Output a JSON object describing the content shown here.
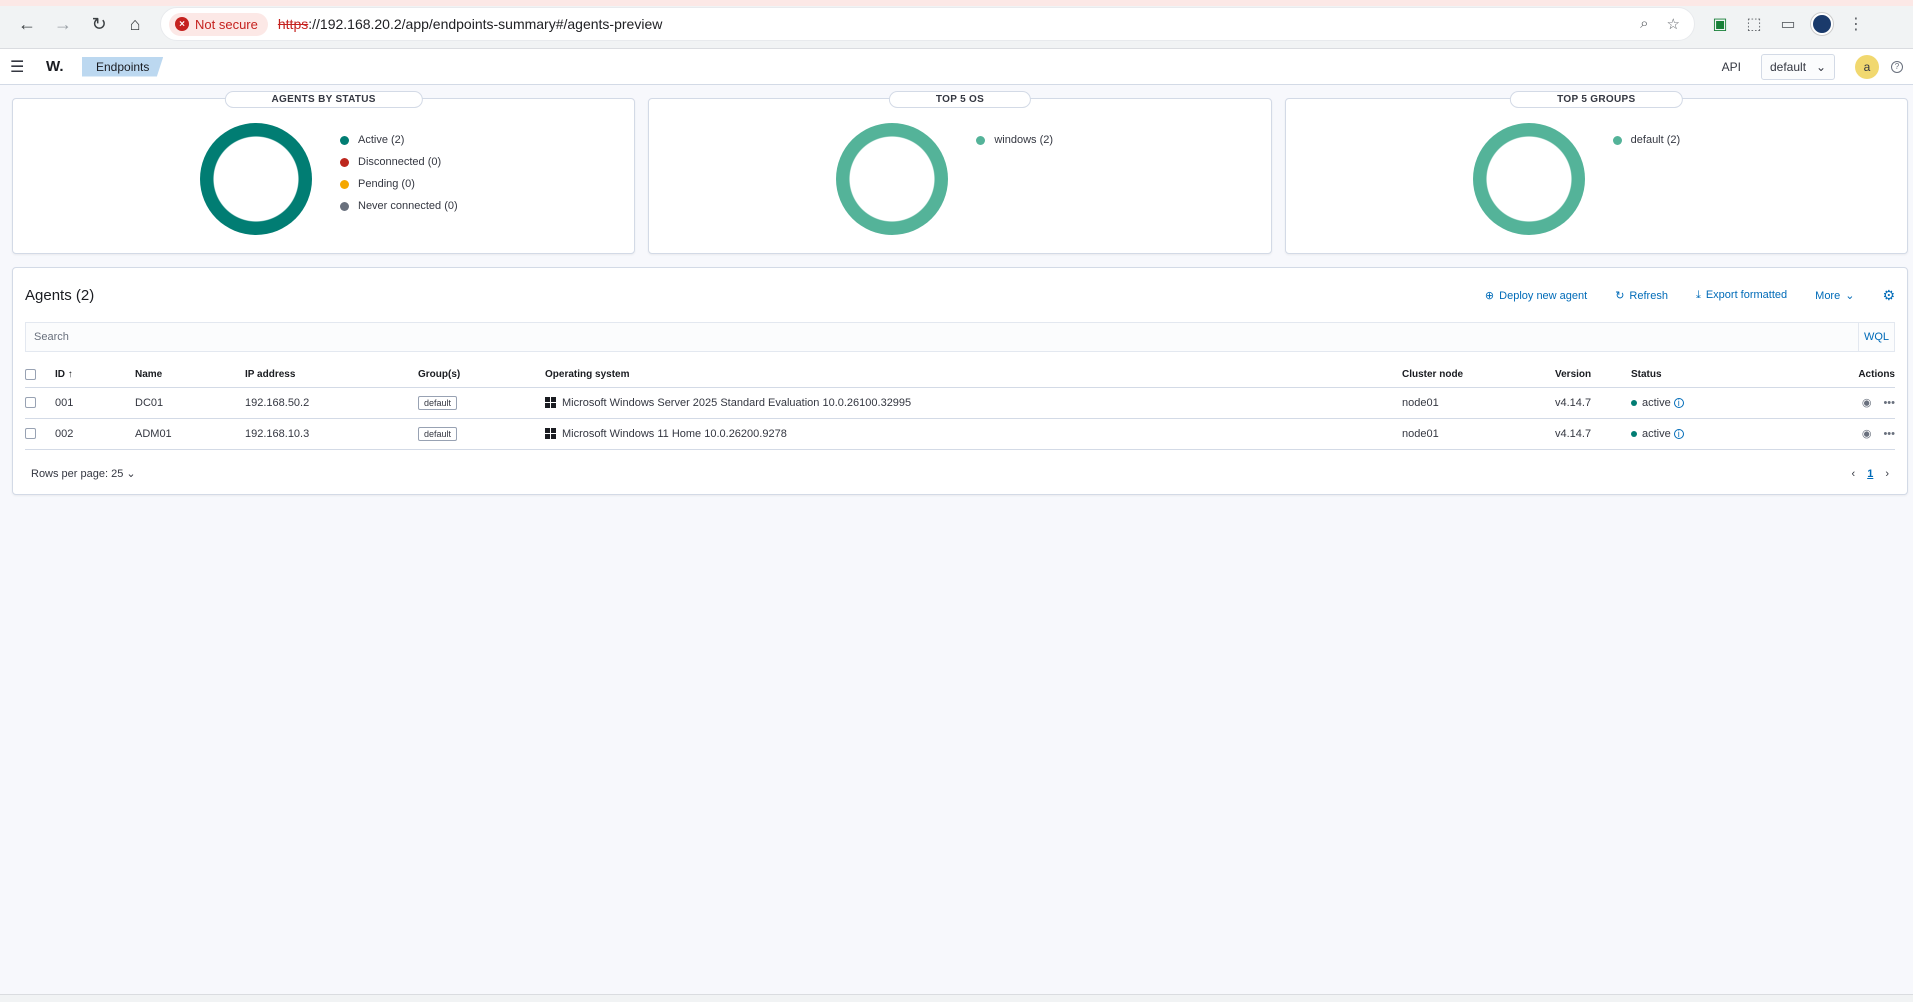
{
  "browser": {
    "not_secure": "Not secure",
    "url_scheme": "https",
    "url_rest": "://192.168.20.2/app/endpoints-summary#/agents-preview"
  },
  "appbar": {
    "logo": "W.",
    "breadcrumb": "Endpoints",
    "api": "API",
    "tenant": "default",
    "avatar": "a"
  },
  "panels": [
    {
      "title": "AGENTS BY STATUS",
      "legend": [
        {
          "label": "Active (2)",
          "color": "#017d73"
        },
        {
          "label": "Disconnected (0)",
          "color": "#bd271e"
        },
        {
          "label": "Pending (0)",
          "color": "#f5a700"
        },
        {
          "label": "Never connected (0)",
          "color": "#69707d"
        }
      ],
      "donut_color": "#017d73"
    },
    {
      "title": "TOP 5 OS",
      "legend": [
        {
          "label": "windows (2)",
          "color": "#54b399"
        }
      ],
      "donut_color": "#54b399"
    },
    {
      "title": "TOP 5 GROUPS",
      "legend": [
        {
          "label": "default (2)",
          "color": "#54b399"
        }
      ],
      "donut_color": "#54b399"
    }
  ],
  "agents": {
    "title": "Agents (2)",
    "actions": {
      "deploy": "Deploy new agent",
      "refresh": "Refresh",
      "export": "Export formatted",
      "more": "More"
    },
    "search_placeholder": "Search",
    "wql": "WQL",
    "columns": {
      "id": "ID",
      "name": "Name",
      "ip": "IP address",
      "groups": "Group(s)",
      "os": "Operating system",
      "cluster": "Cluster node",
      "version": "Version",
      "status": "Status",
      "actions": "Actions"
    },
    "rows": [
      {
        "id": "001",
        "name": "DC01",
        "ip": "192.168.50.2",
        "group": "default",
        "os": "Microsoft Windows Server 2025 Standard Evaluation 10.0.26100.32995",
        "cluster": "node01",
        "version": "v4.14.7",
        "status": "active"
      },
      {
        "id": "002",
        "name": "ADM01",
        "ip": "192.168.10.3",
        "group": "default",
        "os": "Microsoft Windows 11 Home 10.0.26200.9278",
        "cluster": "node01",
        "version": "v4.14.7",
        "status": "active"
      }
    ],
    "rows_per_page": "Rows per page: 25",
    "current_page": "1"
  }
}
